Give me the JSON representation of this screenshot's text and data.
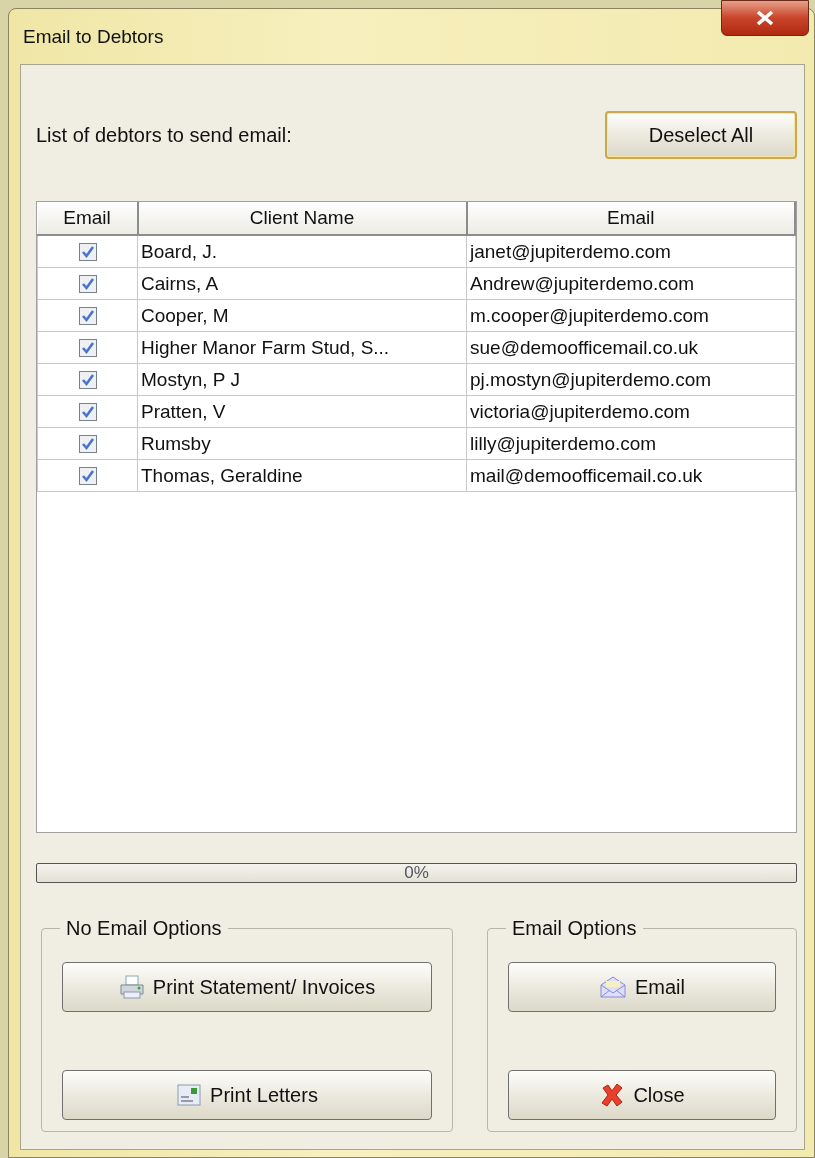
{
  "window": {
    "title": "Email to Debtors"
  },
  "prompt": "List of debtors to send email:",
  "deselect_button": "Deselect All",
  "table": {
    "columns": [
      "Email",
      "Client Name",
      "Email"
    ],
    "rows": [
      {
        "checked": true,
        "client": "Board, J.",
        "email": "janet@jupiterdemo.com"
      },
      {
        "checked": true,
        "client": "Cairns, A",
        "email": "Andrew@jupiterdemo.com"
      },
      {
        "checked": true,
        "client": "Cooper, M",
        "email": "m.cooper@jupiterdemo.com"
      },
      {
        "checked": true,
        "client": "Higher Manor Farm Stud, S...",
        "email": "sue@demoofficemail.co.uk"
      },
      {
        "checked": true,
        "client": "Mostyn, P J",
        "email": "pj.mostyn@jupiterdemo.com"
      },
      {
        "checked": true,
        "client": "Pratten, V",
        "email": "victoria@jupiterdemo.com"
      },
      {
        "checked": true,
        "client": "Rumsby",
        "email": "lilly@jupiterdemo.com"
      },
      {
        "checked": true,
        "client": "Thomas, Geraldine",
        "email": "mail@demoofficemail.co.uk"
      }
    ]
  },
  "progress": {
    "level": 0,
    "reading": "0%"
  },
  "groups": [
    {
      "title": "No Email Options",
      "buttons": [
        {
          "label": "Print Statement/ Invoices",
          "kind": "printer"
        },
        {
          "label": "Print Letters",
          "kind": "card"
        }
      ]
    },
    {
      "title": "Email Options",
      "buttons": [
        {
          "label": "Email",
          "kind": "envelope"
        },
        {
          "label": "Close",
          "kind": "cross"
        }
      ]
    }
  ]
}
